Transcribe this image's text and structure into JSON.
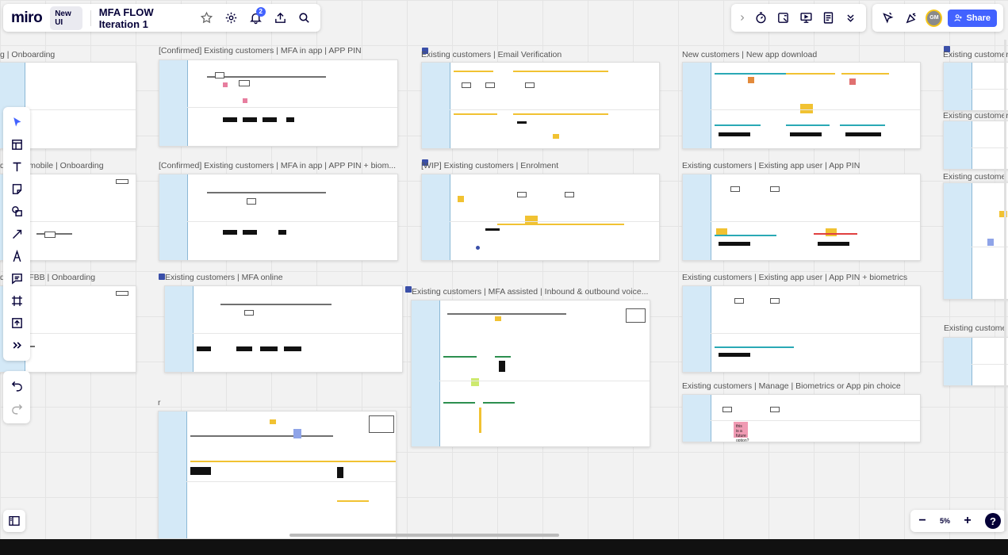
{
  "header": {
    "logo": "miro",
    "badge": "New UI",
    "board_title": "MFA FLOW Iteration 1",
    "notification_count": "2",
    "share_label": "Share",
    "avatar_initials": "GM"
  },
  "zoom": {
    "level": "5%",
    "minus": "−",
    "plus": "+",
    "help": "?"
  },
  "frames": [
    {
      "label": "g | Onboarding"
    },
    {
      "label": "[Confirmed] Existing customers | MFA in app | APP PIN"
    },
    {
      "label": "Existing customers | Email Verification"
    },
    {
      "label": "New customers | New app download"
    },
    {
      "label": "Existing customer"
    },
    {
      "label": "ditional mobile | Onboarding"
    },
    {
      "label": "[Confirmed] Existing customers | MFA in app | APP PIN + biom..."
    },
    {
      "label": "[WIP] Existing customers | Enrolment"
    },
    {
      "label": "Existing customers | Existing app user | App PIN"
    },
    {
      "label": "Existing customer"
    },
    {
      "label": "ditional FBB | Onboarding"
    },
    {
      "label": "Existing customers | MFA online"
    },
    {
      "label": "Existing customers | MFA assisted | Inbound & outbound voice..."
    },
    {
      "label": "Existing customers | Existing app user | App PIN + biometrics"
    },
    {
      "label": "Existing custome"
    },
    {
      "label": "Existing customers | Manage | Biometrics or App pin choice"
    },
    {
      "label": "r"
    }
  ],
  "sticky_note": "this is a future option?"
}
